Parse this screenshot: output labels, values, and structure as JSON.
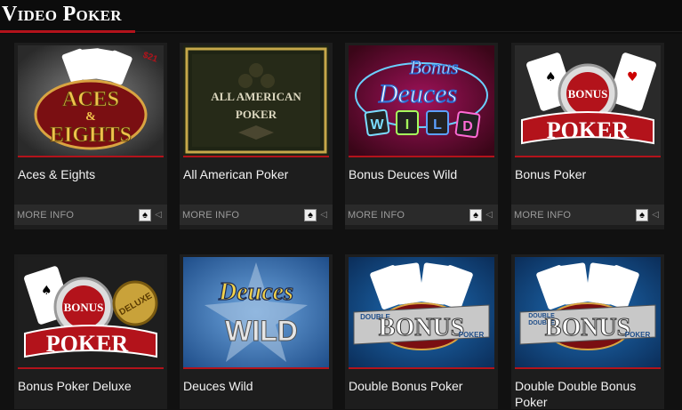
{
  "page": {
    "title": "Video Poker"
  },
  "games": [
    {
      "title": "Aces & Eights",
      "more": "MORE INFO"
    },
    {
      "title": "All American Poker",
      "more": "MORE INFO"
    },
    {
      "title": "Bonus Deuces Wild",
      "more": "MORE INFO"
    },
    {
      "title": "Bonus Poker",
      "more": "MORE INFO"
    },
    {
      "title": "Bonus Poker Deluxe"
    },
    {
      "title": "Deuces Wild"
    },
    {
      "title": "Double Bonus Poker"
    },
    {
      "title": "Double Double Bonus Poker"
    }
  ],
  "thumbs": {
    "aces": {
      "l1": "ACES",
      "l2": "&",
      "l3": "EIGHTS",
      "tag": "$21"
    },
    "american": {
      "l1": "ALL AMERICAN",
      "l2": "POKER"
    },
    "deuces_bonus": {
      "l1": "Bonus",
      "l2": "Deuces",
      "wild": [
        "W",
        "I",
        "L",
        "D"
      ]
    },
    "bonus_poker": {
      "l1": "BONUS",
      "l2": "POKER"
    },
    "deluxe": {
      "l1": "BONUS",
      "l2": "POKER",
      "badge": "DELUXE"
    },
    "deuces_wild": {
      "l1": "Deuces",
      "l2": "WILD"
    },
    "double_bonus": {
      "l1": "DOUBLE",
      "l2": "BONUS",
      "l3": "POKER"
    },
    "double_double": {
      "l1": "DOUBLE",
      "l1b": "DOUBLE",
      "l2": "BONUS",
      "l3": "POKER"
    }
  },
  "icons": {
    "info_icon": "spade-card-icon",
    "arrow_icon": "speaker-arrow-icon"
  },
  "colors": {
    "accent": "#b3131b",
    "card_bg": "#1d1d1d",
    "footer_bg": "#2a2a2a"
  }
}
